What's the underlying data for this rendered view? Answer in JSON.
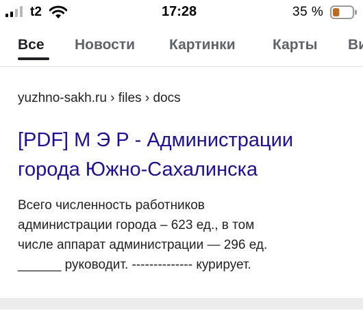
{
  "status_bar": {
    "carrier": "t2",
    "time": "17:28",
    "battery_percent": "35 %",
    "battery_level": 0.35,
    "battery_color": "#c06a1e"
  },
  "tabs": [
    {
      "label": "Все",
      "active": true
    },
    {
      "label": "Новости",
      "active": false
    },
    {
      "label": "Картинки",
      "active": false
    },
    {
      "label": "Карты",
      "active": false
    },
    {
      "label": "Ви",
      "active": false
    }
  ],
  "result": {
    "breadcrumb": "yuzhno-sakh.ru › files › docs",
    "title_line1": "[PDF] М Э Р - Администрации",
    "title_line2": "города Южно-Сахалинска",
    "snippet_lines": [
      "Всего численность работников",
      "администрации города – 623 ед., в том",
      "числе аппарат администрации — 296 ед.",
      "______ руководит. -------------- курирует."
    ]
  },
  "colors": {
    "link": "#1a0dab",
    "text": "#202124",
    "tab_inactive": "#5f6368"
  }
}
